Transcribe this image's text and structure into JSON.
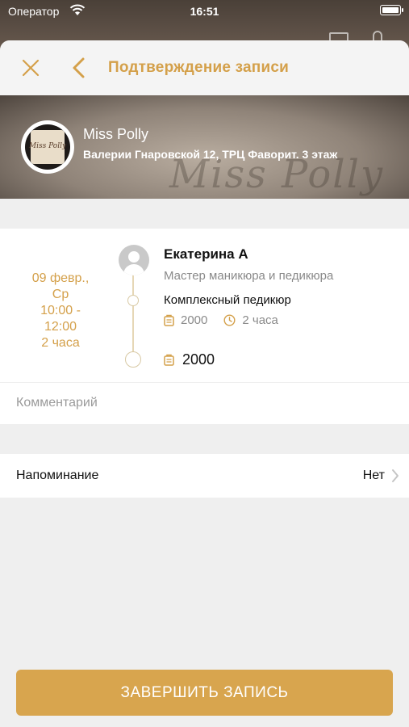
{
  "status_bar": {
    "carrier": "Оператор",
    "time": "16:51"
  },
  "nav": {
    "title": "Подтверждение записи"
  },
  "salon": {
    "name": "Miss Polly",
    "address": "Валерии Гнаровской 12, ТРЦ Фаворит. 3 этаж",
    "watermark": "Miss Polly",
    "logo_text": "Miss Polly"
  },
  "booking": {
    "date_line1": "09 февр.,",
    "date_line2": "Ср",
    "time_line1": "10:00 -",
    "time_line2": "12:00",
    "duration": "2 часа",
    "specialist_name": "Екатерина А",
    "specialist_role": "Мастер маникюра и педикюра",
    "service_name": "Комплексный педикюр",
    "service_price": "2000",
    "service_duration": "2 часа",
    "total_price": "2000"
  },
  "comment": {
    "placeholder": "Комментарий"
  },
  "reminder": {
    "label": "Напоминание",
    "value": "Нет"
  },
  "finish_button": "ЗАВЕРШИТЬ ЗАПИСЬ",
  "colors": {
    "accent": "#d4a04a",
    "button": "#d8a54e",
    "background": "#efefef"
  }
}
